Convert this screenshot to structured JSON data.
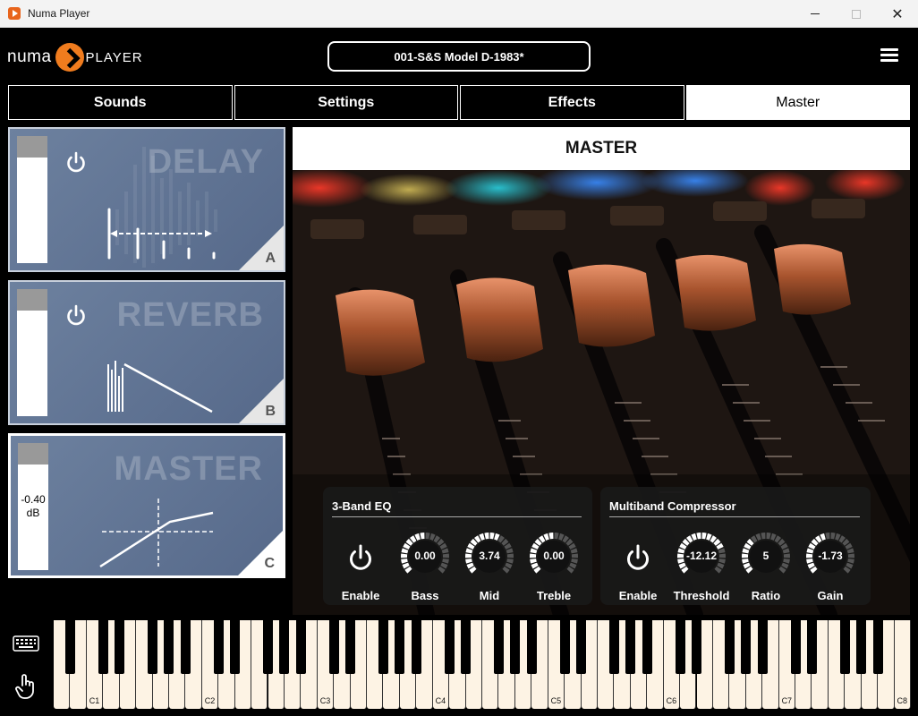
{
  "window": {
    "title": "Numa Player",
    "close_glyph": "✕"
  },
  "header": {
    "logo_numa": "numa",
    "logo_player": "PLAYER",
    "preset": "001-S&S Model D-1983*"
  },
  "tabs": [
    {
      "label": "Sounds"
    },
    {
      "label": "Settings"
    },
    {
      "label": "Effects"
    },
    {
      "label": "Master"
    }
  ],
  "fx_cards": {
    "delay": {
      "title": "DELAY",
      "slot": "A"
    },
    "reverb": {
      "title": "REVERB",
      "slot": "B"
    },
    "master": {
      "title": "MASTER",
      "slot": "C",
      "value": "-0.40",
      "unit": "dB"
    }
  },
  "master": {
    "heading": "MASTER",
    "eq": {
      "title": "3-Band EQ",
      "enable_label": "Enable",
      "bass": {
        "label": "Bass",
        "value": "0.00",
        "level": 0.5
      },
      "mid": {
        "label": "Mid",
        "value": "3.74",
        "level": 0.62
      },
      "treble": {
        "label": "Treble",
        "value": "0.00",
        "level": 0.5
      }
    },
    "compressor": {
      "title": "Multiband Compressor",
      "enable_label": "Enable",
      "threshold": {
        "label": "Threshold",
        "value": "-12.12",
        "level": 0.75
      },
      "ratio": {
        "label": "Ratio",
        "value": "5",
        "level": 0.35
      },
      "gain": {
        "label": "Gain",
        "value": "-1.73",
        "level": 0.45
      }
    }
  },
  "keyboard": {
    "octave_labels": [
      "C1",
      "C2",
      "C3",
      "C4",
      "C5",
      "C6",
      "C7",
      "C8"
    ]
  },
  "colors": {
    "brand_orange": "#f07c1e",
    "card_blue": "#5f7394",
    "knob_active": "#ffffff",
    "knob_inactive": "#555555",
    "key_white": "#fdf3e4"
  }
}
